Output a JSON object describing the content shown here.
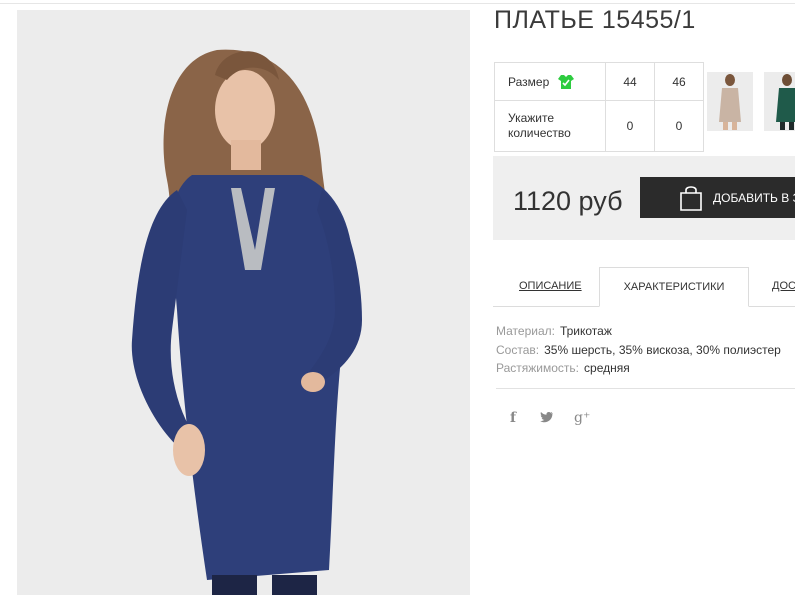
{
  "product": {
    "title": "ПЛАТЬЕ 15455/1",
    "price": "1120 руб",
    "cart_button": "ДОБАВИТЬ В ЗА"
  },
  "size_table": {
    "size_label": "Размер",
    "qty_label_line1": "Укажите",
    "qty_label_line2": "количество",
    "sizes": [
      "44",
      "46"
    ],
    "quantities": [
      "0",
      "0"
    ]
  },
  "tabs": {
    "description": "ОПИСАНИЕ",
    "characteristics": "ХАРАКТЕРИСТИКИ",
    "delivery": "ДОС"
  },
  "specs": [
    {
      "key": "Материал:",
      "value": "Трикотаж"
    },
    {
      "key": "Состав:",
      "value": "35% шерсть, 35% вискоза, 30% полиэстер"
    },
    {
      "key": "Растяжимость:",
      "value": "средняя"
    }
  ],
  "social": {
    "facebook": "f",
    "twitter": "🐦",
    "googleplus": "g⁺"
  },
  "colors": {
    "dress_blue": "#2e3f7a",
    "button_dark": "#2b2b2b",
    "check_green": "#2ecc40",
    "price_bg": "#efefef"
  },
  "icons": {
    "size_check": "dress-check-icon",
    "cart": "shopping-bag-icon"
  }
}
